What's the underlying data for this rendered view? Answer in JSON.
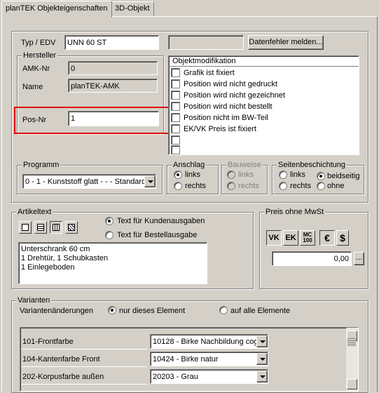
{
  "tabs": [
    {
      "label": "planTEK Objekteigenschaften",
      "active": true
    },
    {
      "label": "3D-Objekt",
      "active": false
    }
  ],
  "top": {
    "typ_label": "Typ / EDV",
    "typ_value": "UNN 60 ST",
    "secondary_value": "",
    "report_button": "Datenfehler melden..."
  },
  "hersteller": {
    "title": "Hersteller",
    "amk_label": "AMK-Nr",
    "amk_value": "0",
    "name_label": "Name",
    "name_value": "planTEK-AMK",
    "pos_label": "Pos-Nr",
    "pos_value": "1"
  },
  "objektmodifikation": {
    "title": "Objektmodifikation",
    "items": [
      "Grafik ist fixiert",
      "Position wird nicht gedruckt",
      "Position wird nicht gezeichnet",
      "Position wird nicht bestellt",
      "Position nicht im BW-Teil",
      "EK/VK Preis ist fixiert"
    ]
  },
  "programm": {
    "title": "Programm",
    "selected": "0 - 1 - Kunststoff glatt - - - Standard"
  },
  "anschlag": {
    "title": "Anschlag",
    "options": [
      "links",
      "rechts"
    ]
  },
  "bauweise": {
    "title": "Bauweise",
    "options": [
      "links",
      "rechts"
    ]
  },
  "seitenbeschichtung": {
    "title": "Seitenbeschichtung",
    "options": [
      "links",
      "beidseitig",
      "rechts",
      "ohne"
    ]
  },
  "artikeltext": {
    "title": "Artikeltext",
    "radio_kunde": "Text für Kundenausgaben",
    "radio_bestell": "Text für Bestellausgabe",
    "lines": [
      "Unterschrank 60 cm",
      "1 Drehtür, 1 Schubkasten",
      "1 Einlegeboden"
    ]
  },
  "preis": {
    "title": "Preis ohne MwSt",
    "vk": "VK",
    "ek": "EK",
    "mc_top": "MC",
    "mc_bottom": "100",
    "euro": "€",
    "dollar": "$",
    "value": "0,00",
    "more": "..."
  },
  "varianten": {
    "title": "Varianten",
    "changes_label": "Variantenänderungen",
    "radio_this": "nur dieses Element",
    "radio_all": "auf alle Elemente",
    "rows": [
      {
        "name": "101-Frontfarbe",
        "value": "10128 - Birke Nachbildung cog"
      },
      {
        "name": "104-Kantenfarbe Front",
        "value": "10424 - Birke natur"
      },
      {
        "name": "202-Korpusfarbe außen",
        "value": "20203 - Grau"
      }
    ]
  },
  "colors": {
    "highlight_box": "#e00000",
    "dialog_bg": "#d4d0c8"
  }
}
